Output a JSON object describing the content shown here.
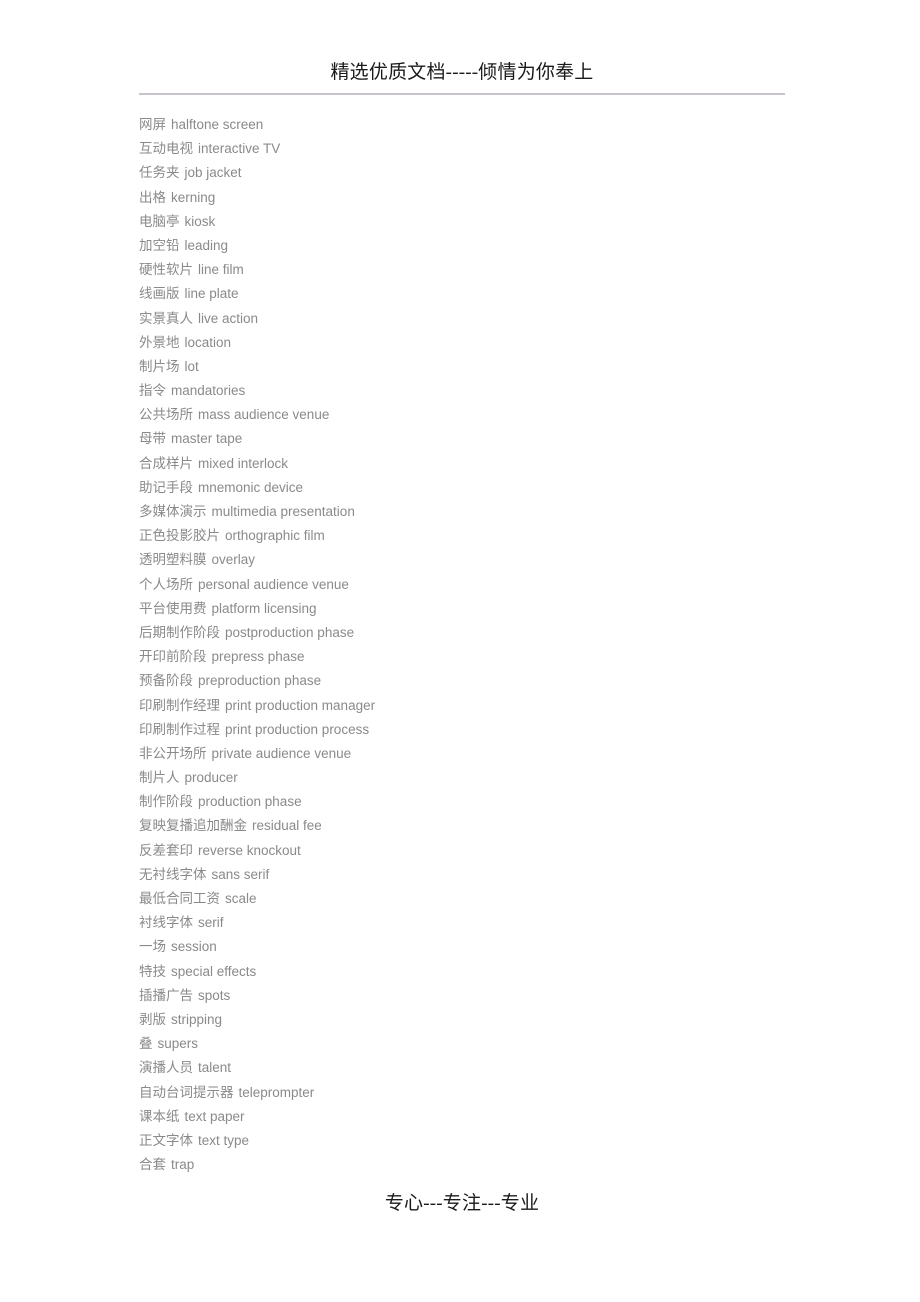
{
  "document": {
    "header": {
      "title": "精选优质文档-----倾情为你奉上"
    },
    "footer": {
      "text": "专心---专注---专业"
    },
    "colors": {
      "header_text": "#1a1a1a",
      "body_text": "#8a8a8a",
      "rule": "#c9c3cd",
      "page_background": "#ffffff"
    },
    "glossary": [
      {
        "cn": "网屏",
        "en": "halftone screen"
      },
      {
        "cn": "互动电视",
        "en": "interactive TV"
      },
      {
        "cn": "任务夹",
        "en": "job jacket"
      },
      {
        "cn": "出格",
        "en": "kerning"
      },
      {
        "cn": "电脑亭",
        "en": "kiosk"
      },
      {
        "cn": "加空铅",
        "en": "leading"
      },
      {
        "cn": "硬性软片",
        "en": "line film"
      },
      {
        "cn": "线画版",
        "en": "line plate"
      },
      {
        "cn": "实景真人",
        "en": "live action"
      },
      {
        "cn": "外景地",
        "en": "location"
      },
      {
        "cn": "制片场",
        "en": "lot"
      },
      {
        "cn": "指令",
        "en": "mandatories"
      },
      {
        "cn": "公共场所",
        "en": "mass audience venue"
      },
      {
        "cn": "母带",
        "en": "master tape"
      },
      {
        "cn": "合成样片",
        "en": "mixed interlock"
      },
      {
        "cn": "助记手段",
        "en": "mnemonic device"
      },
      {
        "cn": "多媒体演示",
        "en": "multimedia presentation"
      },
      {
        "cn": "正色投影胶片",
        "en": "orthographic film"
      },
      {
        "cn": "透明塑料膜",
        "en": "overlay"
      },
      {
        "cn": "个人场所",
        "en": "personal audience venue"
      },
      {
        "cn": "平台使用费",
        "en": "platform licensing"
      },
      {
        "cn": "后期制作阶段",
        "en": "postproduction phase"
      },
      {
        "cn": "开印前阶段",
        "en": "prepress phase"
      },
      {
        "cn": "预备阶段",
        "en": "preproduction phase"
      },
      {
        "cn": "印刷制作经理",
        "en": "print production manager"
      },
      {
        "cn": "印刷制作过程",
        "en": "print production process"
      },
      {
        "cn": "非公开场所",
        "en": "private audience venue"
      },
      {
        "cn": "制片人",
        "en": "producer"
      },
      {
        "cn": "制作阶段",
        "en": "production phase"
      },
      {
        "cn": "复映复播追加酬金",
        "en": "residual fee"
      },
      {
        "cn": "反差套印",
        "en": "reverse knockout"
      },
      {
        "cn": "无衬线字体",
        "en": "sans serif"
      },
      {
        "cn": "最低合同工资",
        "en": "scale"
      },
      {
        "cn": "衬线字体",
        "en": "serif"
      },
      {
        "cn": "一场",
        "en": "session"
      },
      {
        "cn": "特技",
        "en": "special effects"
      },
      {
        "cn": "插播广告",
        "en": "spots"
      },
      {
        "cn": "剥版",
        "en": "stripping"
      },
      {
        "cn": "叠",
        "en": "supers"
      },
      {
        "cn": "演播人员",
        "en": "talent"
      },
      {
        "cn": "自动台词提示器",
        "en": "teleprompter"
      },
      {
        "cn": "课本纸",
        "en": "text paper"
      },
      {
        "cn": "正文字体",
        "en": "text type"
      },
      {
        "cn": "合套",
        "en": "trap"
      }
    ]
  }
}
